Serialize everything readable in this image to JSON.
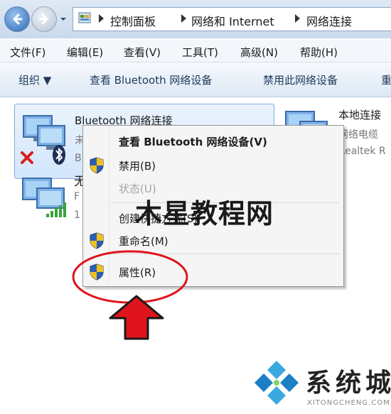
{
  "address_bar": {
    "crumbs": [
      "控制面板",
      "网络和 Internet",
      "网络连接"
    ]
  },
  "menubar": {
    "items": [
      "文件(F)",
      "编辑(E)",
      "查看(V)",
      "工具(T)",
      "高级(N)",
      "帮助(H)"
    ]
  },
  "commandbar": {
    "organize": "组织 ▼",
    "view_bluetooth": "查看 Bluetooth 网络设备",
    "disable_device": "禁用此网络设备",
    "overflow": "重"
  },
  "items": [
    {
      "name": "Bluetooth 网络连接",
      "status": "未",
      "device": "B"
    },
    {
      "name": "无",
      "status": "F",
      "device": "1"
    },
    {
      "name": "本地连接",
      "status": "网络电缆",
      "device": "Realtek R"
    }
  ],
  "context_menu": {
    "items": [
      {
        "label": "查看 Bluetooth 网络设备(V)",
        "bold": true,
        "disabled": false,
        "shield": false
      },
      {
        "label": "禁用(B)",
        "bold": false,
        "disabled": false,
        "shield": true
      },
      {
        "label": "状态(U)",
        "bold": false,
        "disabled": true,
        "shield": false
      },
      {
        "label": "创建快捷方式(S)",
        "bold": false,
        "disabled": false,
        "shield": false
      },
      {
        "label": "重命名(M)",
        "bold": false,
        "disabled": false,
        "shield": true
      },
      {
        "label": "属性(R)",
        "bold": false,
        "disabled": false,
        "shield": true
      }
    ]
  },
  "overlays": {
    "watermark": "木星教程网",
    "logo_text": "系统城",
    "logo_sub": "XITONGCHENG.COM"
  },
  "colors": {
    "annotation_red": "#e0141c",
    "selection_border": "#84acdd",
    "shield_blue": "#2d5fb3",
    "shield_yellow": "#f2c21b"
  },
  "icons": {
    "back": "back-arrow-icon",
    "forward": "forward-arrow-icon",
    "error": "red-x-icon",
    "bluetooth": "bluetooth-icon",
    "signal": "signal-bars-icon",
    "uac": "uac-shield-icon"
  }
}
